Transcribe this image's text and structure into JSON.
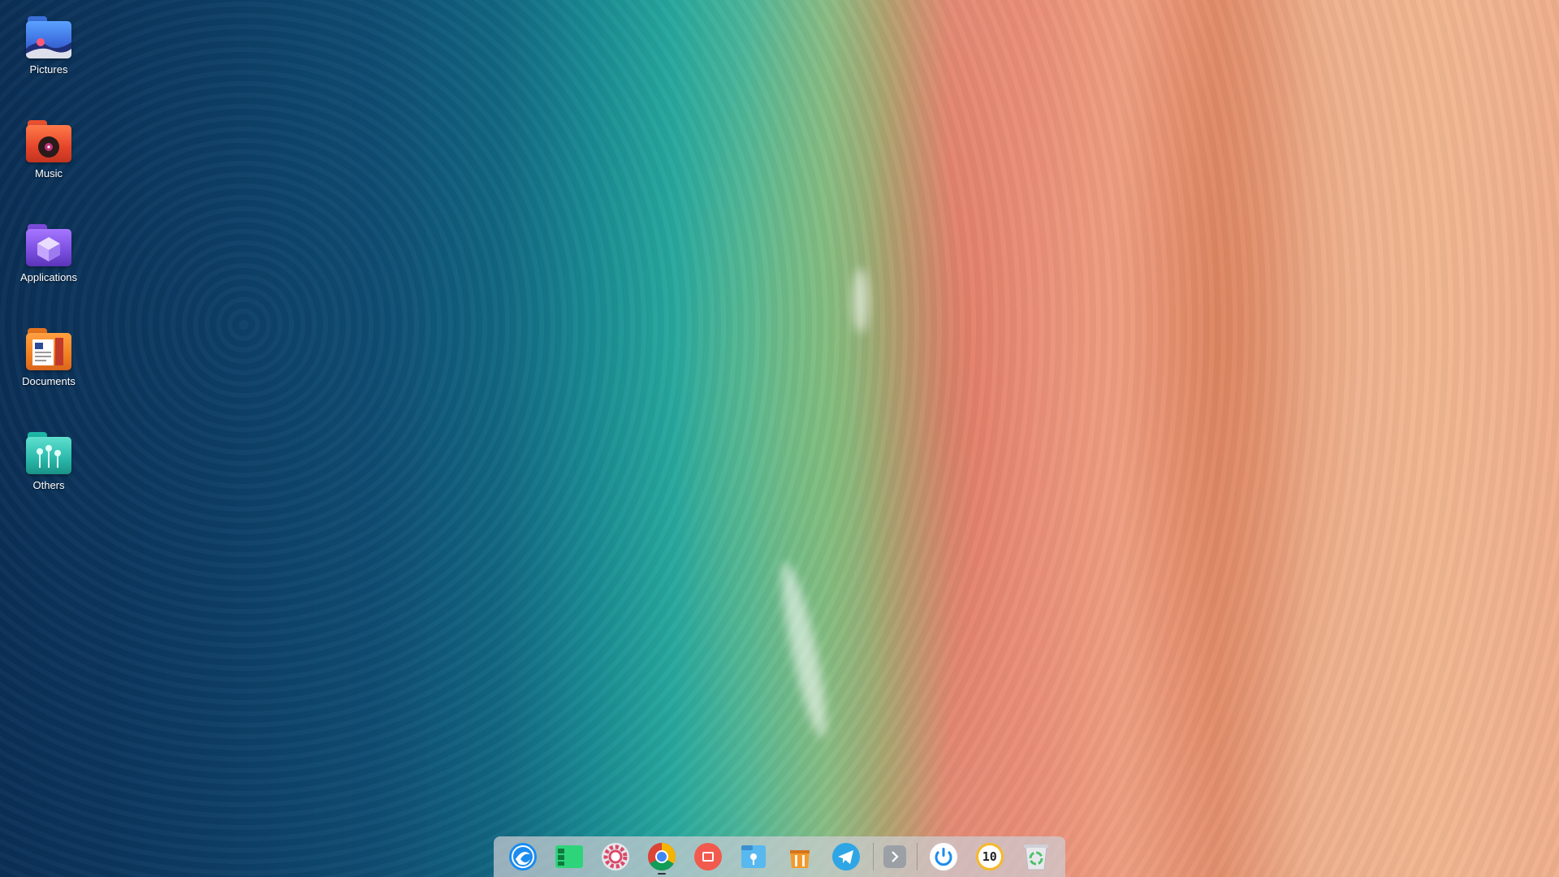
{
  "desktop": {
    "icons": [
      {
        "label": "Pictures",
        "icon": "pictures-folder-icon"
      },
      {
        "label": "Music",
        "icon": "music-folder-icon"
      },
      {
        "label": "Applications",
        "icon": "applications-folder-icon"
      },
      {
        "label": "Documents",
        "icon": "documents-folder-icon"
      },
      {
        "label": "Others",
        "icon": "others-folder-icon"
      }
    ]
  },
  "dock": {
    "items": [
      {
        "icon": "launcher-icon"
      },
      {
        "icon": "multitasking-icon"
      },
      {
        "icon": "settings-icon"
      },
      {
        "icon": "chrome-icon"
      },
      {
        "icon": "screen-recorder-icon"
      },
      {
        "icon": "file-manager-icon"
      },
      {
        "icon": "app-store-icon"
      },
      {
        "icon": "telegram-icon"
      },
      {
        "icon": "expand-tray-icon"
      },
      {
        "icon": "power-icon"
      },
      {
        "icon": "clock-icon"
      },
      {
        "icon": "trash-icon"
      }
    ],
    "clock_text": "10"
  }
}
